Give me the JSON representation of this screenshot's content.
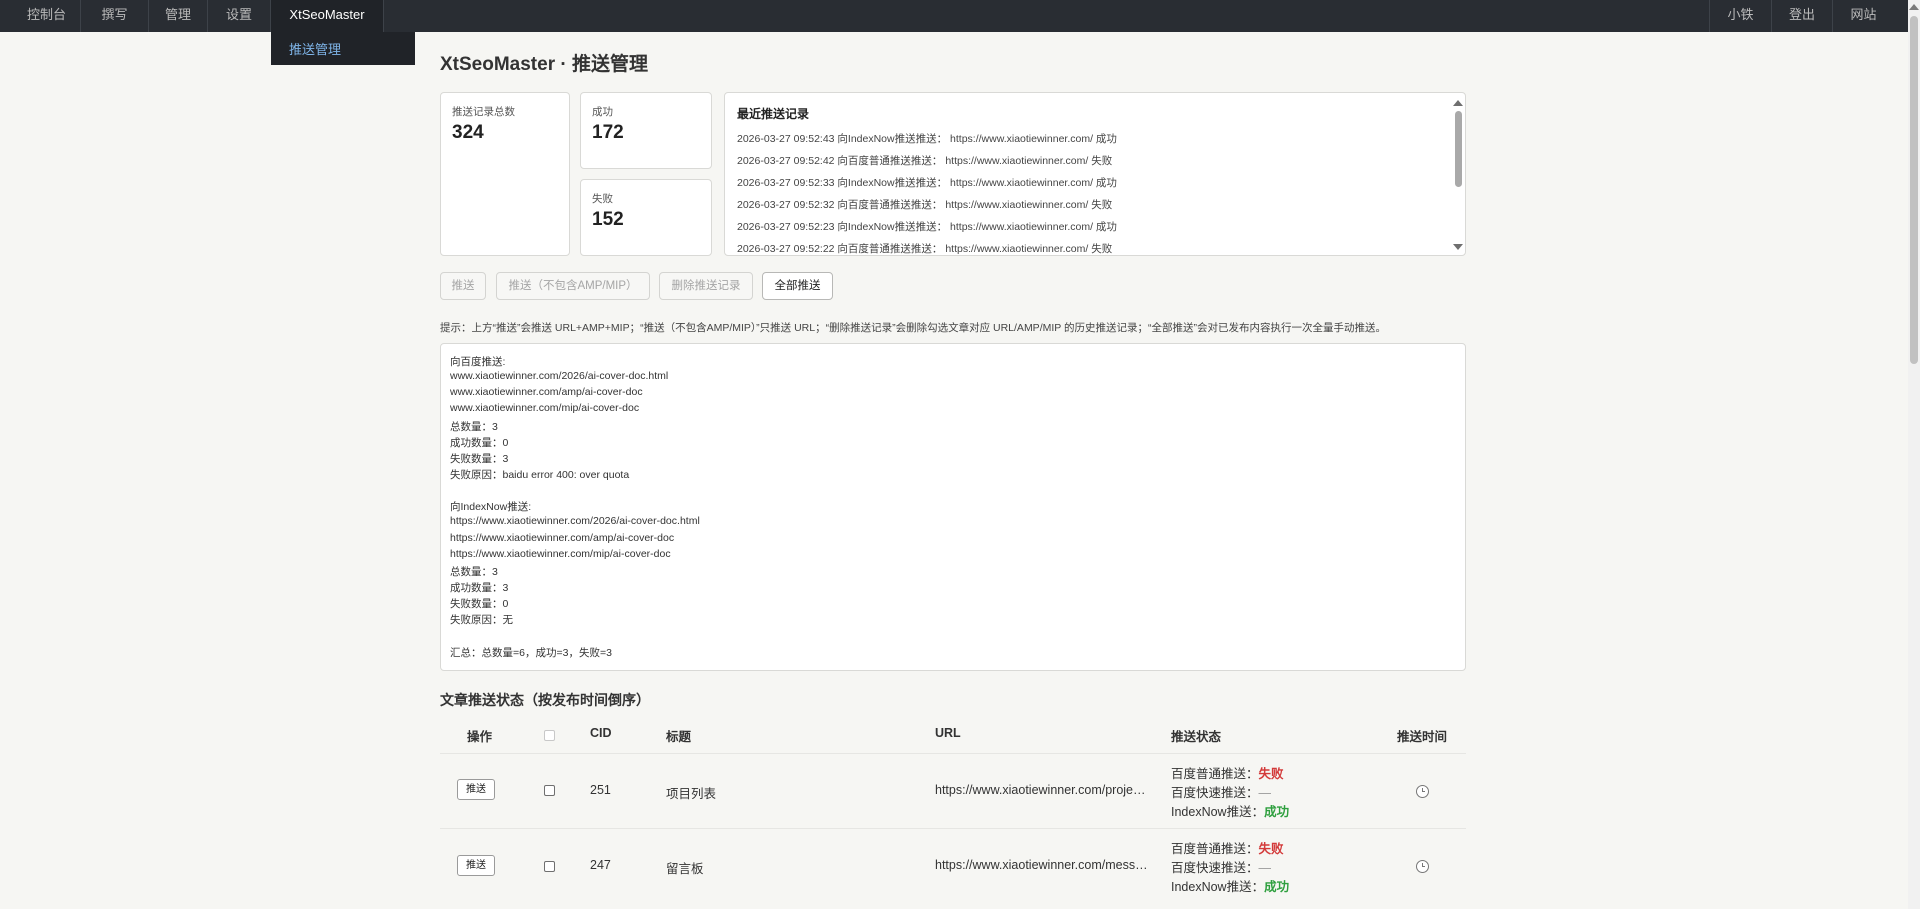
{
  "nav": {
    "left": [
      "控制台",
      "撰写",
      "管理",
      "设置",
      "XtSeoMaster"
    ],
    "right": [
      "小铁",
      "登出",
      "网站"
    ],
    "submenu": "推送管理"
  },
  "page": {
    "title": "XtSeoMaster · 推送管理"
  },
  "stats": {
    "total": {
      "label": "推送记录总数",
      "value": "324"
    },
    "success": {
      "label": "成功",
      "value": "172"
    },
    "fail": {
      "label": "失败",
      "value": "152"
    }
  },
  "recent": {
    "title": "最近推送记录",
    "lines": [
      "2026-03-27 09:52:43 向IndexNow推送推送： https://www.xiaotiewinner.com/ 成功",
      "2026-03-27 09:52:42 向百度普通推送推送： https://www.xiaotiewinner.com/ 失败",
      "2026-03-27 09:52:33 向IndexNow推送推送： https://www.xiaotiewinner.com/ 成功",
      "2026-03-27 09:52:32 向百度普通推送推送： https://www.xiaotiewinner.com/ 失败",
      "2026-03-27 09:52:23 向IndexNow推送推送： https://www.xiaotiewinner.com/ 成功",
      "2026-03-27 09:52:22 向百度普通推送推送： https://www.xiaotiewinner.com/ 失败"
    ]
  },
  "buttons": {
    "push": "推送",
    "push_no_amp": "推送（不包含AMP/MIP）",
    "delete_records": "删除推送记录",
    "push_all": "全部推送"
  },
  "hint": "提示：上方“推送”会推送 URL+AMP+MIP；“推送（不包含AMP/MIP）”只推送 URL；“删除推送记录”会删除勾选文章对应 URL/AMP/MIP 的历史推送记录；“全部推送”会对已发布内容执行一次全量手动推送。",
  "result_lines": [
    "向百度推送:",
    "www.xiaotiewinner.com/2026/ai-cover-doc.html",
    "www.xiaotiewinner.com/amp/ai-cover-doc",
    "www.xiaotiewinner.com/mip/ai-cover-doc",
    "总数量：3",
    "成功数量：0",
    "失败数量：3",
    "失败原因：baidu error 400: over quota",
    "",
    "向IndexNow推送:",
    "https://www.xiaotiewinner.com/2026/ai-cover-doc.html",
    "https://www.xiaotiewinner.com/amp/ai-cover-doc",
    "https://www.xiaotiewinner.com/mip/ai-cover-doc",
    "总数量：3",
    "成功数量：3",
    "失败数量：0",
    "失败原因：无",
    "",
    "汇总：总数量=6，成功=3，失败=3"
  ],
  "table": {
    "title": "文章推送状态（按发布时间倒序）",
    "headers": {
      "action": "操作",
      "cid": "CID",
      "title": "标题",
      "url": "URL",
      "status": "推送状态",
      "time": "推送时间"
    },
    "row_button": "推送",
    "status_labels": {
      "baidu_normal": "百度普通推送：",
      "baidu_fast": "百度快速推送：",
      "indexnow": "IndexNow推送："
    },
    "rows": [
      {
        "cid": "251",
        "title": "项目列表",
        "url": "https://www.xiaotiewinner.com/projects/",
        "baidu_normal": "失败",
        "baidu_fast": "—",
        "indexnow": "成功"
      },
      {
        "cid": "247",
        "title": "留言板",
        "url": "https://www.xiaotiewinner.com/message/",
        "baidu_normal": "失败",
        "baidu_fast": "—",
        "indexnow": "成功"
      }
    ]
  }
}
